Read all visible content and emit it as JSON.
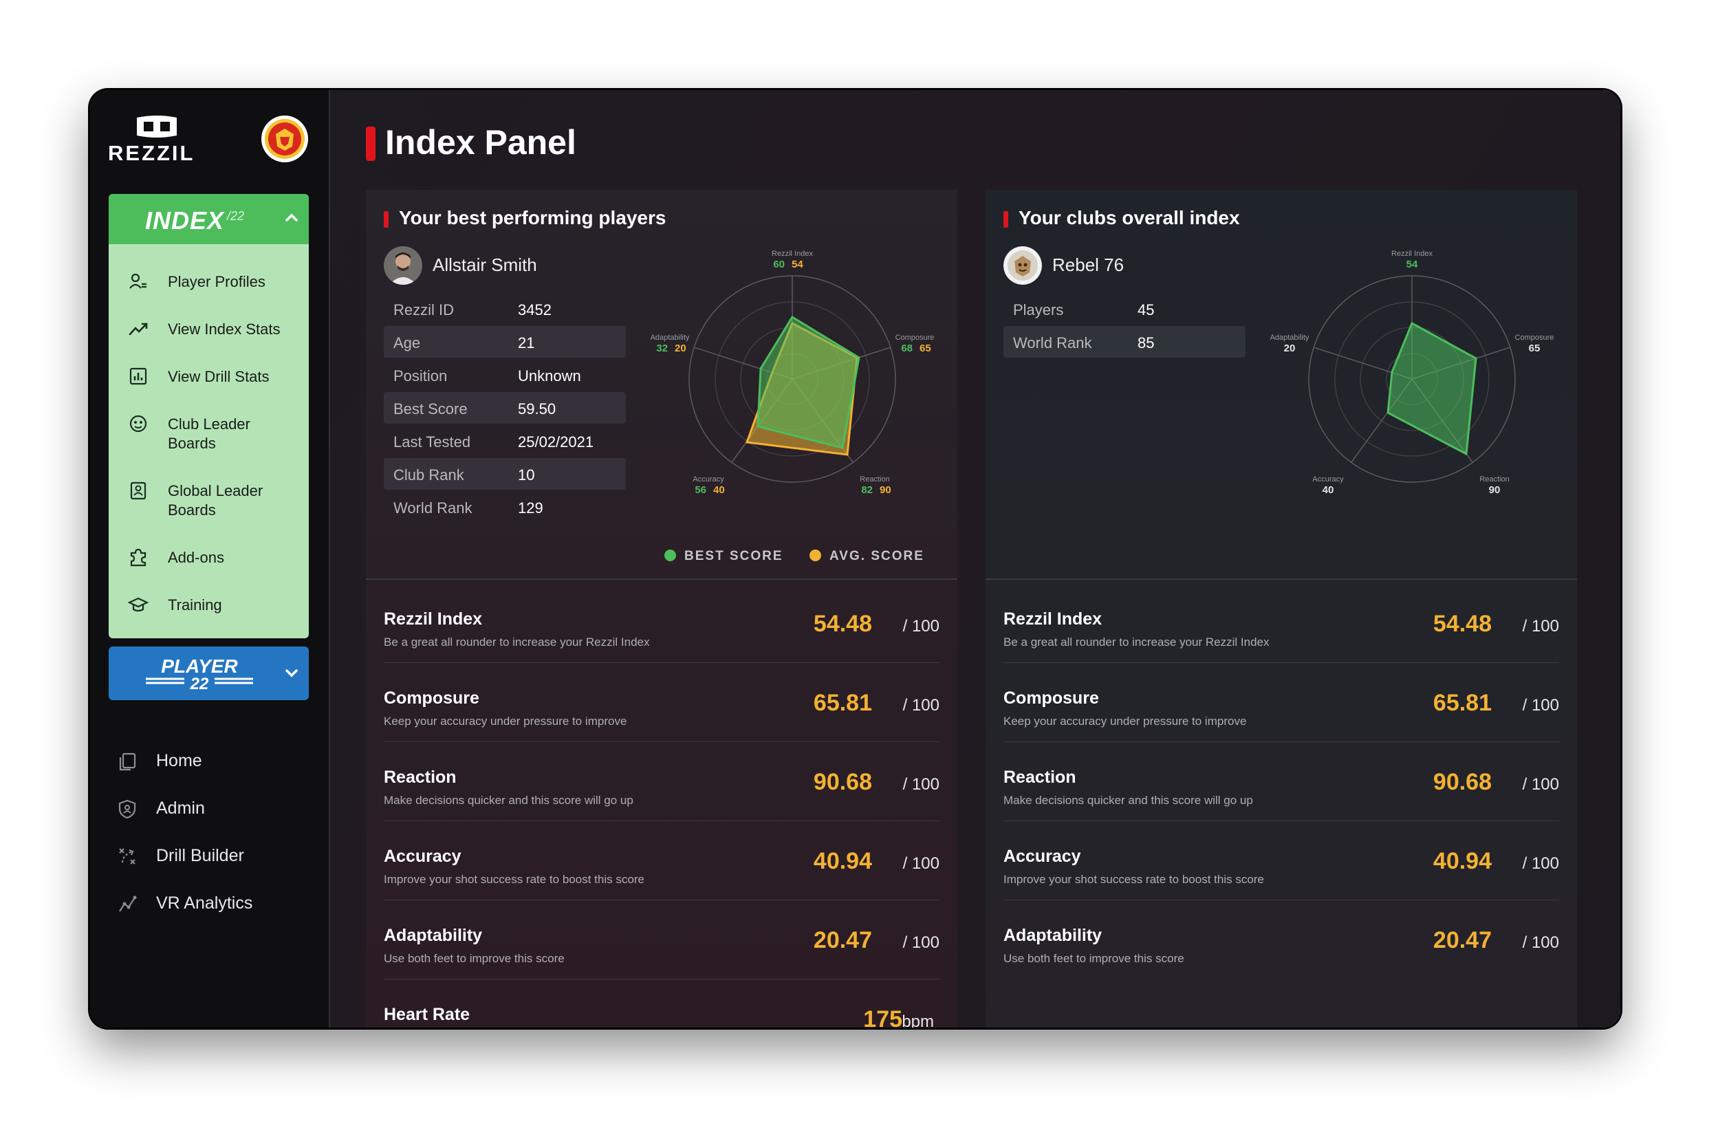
{
  "app": {
    "brand": "REZZIL"
  },
  "sidebar": {
    "index": {
      "title": "INDEX",
      "year": "/22"
    },
    "index_items": [
      {
        "label": "Player Profiles",
        "icon": "user-group-icon"
      },
      {
        "label": "View Index Stats",
        "icon": "trend-line-icon"
      },
      {
        "label": "View Drill Stats",
        "icon": "bar-chart-icon"
      },
      {
        "label": "Club Leader Boards",
        "icon": "smiley-group-icon"
      },
      {
        "label": "Global Leader Boards",
        "icon": "badge-icon"
      },
      {
        "label": "Add-ons",
        "icon": "puzzle-icon"
      },
      {
        "label": "Training",
        "icon": "graduation-cap-icon"
      }
    ],
    "player_product": {
      "line1": "PLAYER",
      "line2": "22"
    },
    "nav": [
      {
        "label": "Home",
        "icon": "copy-pages-icon"
      },
      {
        "label": "Admin",
        "icon": "shield-icon"
      },
      {
        "label": "Drill Builder",
        "icon": "tactics-icon"
      },
      {
        "label": "VR Analytics",
        "icon": "analytics-line-icon"
      }
    ]
  },
  "page": {
    "title": "Index Panel"
  },
  "best_players": {
    "heading": "Your best performing players",
    "name": "Allstair Smith",
    "info": [
      {
        "k": "Rezzil ID",
        "v": "3452"
      },
      {
        "k": "Age",
        "v": "21"
      },
      {
        "k": "Position",
        "v": "Unknown"
      },
      {
        "k": "Best Score",
        "v": "59.50"
      },
      {
        "k": "Last Tested",
        "v": "25/02/2021"
      },
      {
        "k": "Club Rank",
        "v": "10"
      },
      {
        "k": "World Rank",
        "v": "129"
      }
    ],
    "radar": {
      "axes": [
        {
          "label": "Rezzil Index",
          "best": "60",
          "avg": "54"
        },
        {
          "label": "Composure",
          "best": "68",
          "avg": "65"
        },
        {
          "label": "Reaction",
          "best": "82",
          "avg": "90"
        },
        {
          "label": "Accuracy",
          "best": "56",
          "avg": "40"
        },
        {
          "label": "Adaptability",
          "best": "32",
          "avg": "20"
        }
      ]
    },
    "legend": {
      "best": "BEST SCORE",
      "avg": "AVG. SCORE"
    },
    "metrics": [
      {
        "title": "Rezzil Index",
        "desc": "Be a great all rounder to increase your Rezzil Index",
        "value": "54.48",
        "unit": "/ 100"
      },
      {
        "title": "Composure",
        "desc": "Keep your accuracy under pressure to improve",
        "value": "65.81",
        "unit": "/ 100"
      },
      {
        "title": "Reaction",
        "desc": "Make decisions quicker and this score will go up",
        "value": "90.68",
        "unit": "/ 100"
      },
      {
        "title": "Accuracy",
        "desc": "Improve your shot success rate to boost this score",
        "value": "40.94",
        "unit": "/ 100"
      },
      {
        "title": "Adaptability",
        "desc": "Use both feet to improve this score",
        "value": "20.47",
        "unit": "/ 100"
      },
      {
        "title": "Heart Rate",
        "desc": "",
        "value": "175",
        "unit": "bpm"
      }
    ]
  },
  "club_index": {
    "heading": "Your clubs overall index",
    "name": "Rebel 76",
    "info": [
      {
        "k": "Players",
        "v": "45"
      },
      {
        "k": "World Rank",
        "v": "85"
      }
    ],
    "radar": {
      "axes": [
        {
          "label": "Rezzil Index",
          "value": "54"
        },
        {
          "label": "Composure",
          "value": "65"
        },
        {
          "label": "Reaction",
          "value": "90"
        },
        {
          "label": "Accuracy",
          "value": "40"
        },
        {
          "label": "Adaptability",
          "value": "20"
        }
      ]
    },
    "metrics": [
      {
        "title": "Rezzil Index",
        "desc": "Be a great all rounder to increase your Rezzil Index",
        "value": "54.48",
        "unit": "/ 100"
      },
      {
        "title": "Composure",
        "desc": "Keep your accuracy under pressure to improve",
        "value": "65.81",
        "unit": "/ 100"
      },
      {
        "title": "Reaction",
        "desc": "Make decisions quicker and this score will go up",
        "value": "90.68",
        "unit": "/ 100"
      },
      {
        "title": "Accuracy",
        "desc": "Improve your shot success rate to boost this score",
        "value": "40.94",
        "unit": "/ 100"
      },
      {
        "title": "Adaptability",
        "desc": "Use both feet to improve this score",
        "value": "20.47",
        "unit": "/ 100"
      }
    ]
  },
  "colors": {
    "accent_red": "#e0141c",
    "best_green": "#4dbd5c",
    "avg_yellow": "#f3b233",
    "index_panel": "#b4e4b6",
    "player_blue": "#2576c2"
  }
}
